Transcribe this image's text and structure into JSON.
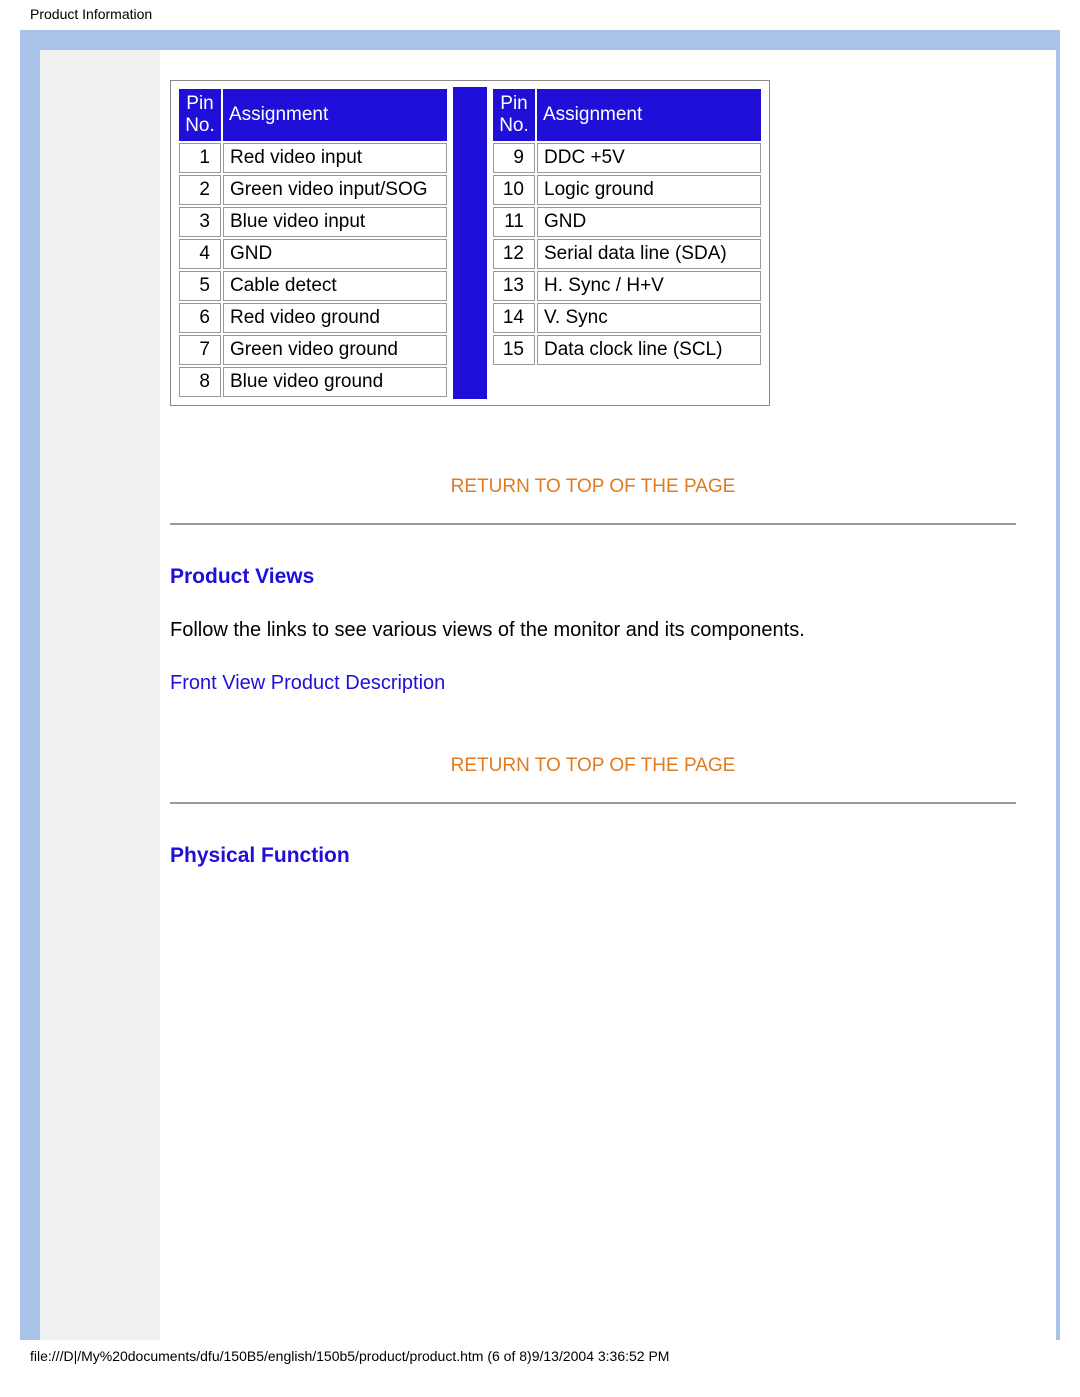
{
  "page_title": "Product Information",
  "pin_table": {
    "headers": {
      "pin": "Pin No.",
      "assign": "Assignment"
    },
    "left": [
      {
        "no": "1",
        "assign": "Red video input"
      },
      {
        "no": "2",
        "assign": "Green video input/SOG"
      },
      {
        "no": "3",
        "assign": "Blue video input"
      },
      {
        "no": "4",
        "assign": "GND"
      },
      {
        "no": "5",
        "assign": "Cable detect"
      },
      {
        "no": "6",
        "assign": "Red video ground"
      },
      {
        "no": "7",
        "assign": "Green video ground"
      },
      {
        "no": "8",
        "assign": "Blue video ground"
      }
    ],
    "right": [
      {
        "no": "9",
        "assign": "DDC +5V"
      },
      {
        "no": "10",
        "assign": "Logic ground"
      },
      {
        "no": "11",
        "assign": "GND"
      },
      {
        "no": "12",
        "assign": "Serial data line (SDA)"
      },
      {
        "no": "13",
        "assign": "H. Sync / H+V"
      },
      {
        "no": "14",
        "assign": "V. Sync"
      },
      {
        "no": "15",
        "assign": "Data clock line (SCL)"
      }
    ]
  },
  "links": {
    "return_top": "RETURN TO TOP OF THE PAGE",
    "front_view": "Front View Product Description"
  },
  "sections": {
    "product_views": "Product Views",
    "product_views_text": "Follow the links to see various views of the monitor and its components.",
    "physical_function": "Physical Function"
  },
  "footer": "file:///D|/My%20documents/dfu/150B5/english/150b5/product/product.htm (6 of 8)9/13/2004 3:36:52 PM"
}
